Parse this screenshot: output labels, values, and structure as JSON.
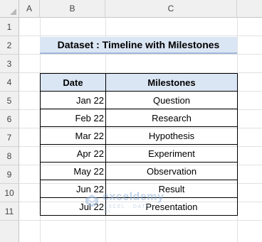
{
  "columns": [
    "A",
    "B",
    "C"
  ],
  "rows": [
    "1",
    "2",
    "3",
    "4",
    "5",
    "6",
    "7",
    "8",
    "9",
    "10",
    "11"
  ],
  "title": "Dataset : Timeline with Milestones",
  "table": {
    "headers": {
      "date": "Date",
      "milestones": "Milestones"
    },
    "rows": [
      {
        "date": "Jan 22",
        "milestone": "Question"
      },
      {
        "date": "Feb 22",
        "milestone": "Research"
      },
      {
        "date": "Mar 22",
        "milestone": "Hypothesis"
      },
      {
        "date": "Apr 22",
        "milestone": "Experiment"
      },
      {
        "date": "May 22",
        "milestone": "Observation"
      },
      {
        "date": "Jun 22",
        "milestone": "Result"
      },
      {
        "date": "Jul 22",
        "milestone": "Presentation"
      }
    ]
  },
  "watermark": {
    "name": "exceldemy",
    "tagline": "EXCEL · DATA · BI",
    "icon": "exceldemy-logo-icon"
  },
  "colors": {
    "header_fill": "#dbe6f4",
    "title_underline": "#9fb6d8",
    "grid": "#e1e1e1",
    "sheet_header": "#f0f0f0"
  }
}
